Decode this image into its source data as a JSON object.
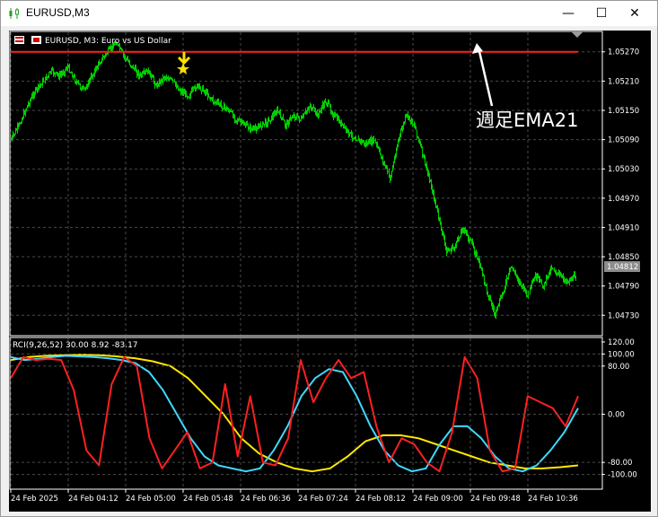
{
  "window": {
    "title": "EURUSD,M3",
    "controls": {
      "minimize": "—",
      "maximize": "☐",
      "close": "✕"
    }
  },
  "chart": {
    "header_label": "EURUSD, M3:  Euro vs US Dollar",
    "annotation": "週足EMA21",
    "current_price": "1.04812",
    "price_axis": [
      "1.05270",
      "1.05210",
      "1.05150",
      "1.05090",
      "1.05030",
      "1.04970",
      "1.04910",
      "1.04850",
      "1.04790",
      "1.04730"
    ],
    "time_axis": [
      "24 Feb 2025",
      "24 Feb 04:12",
      "24 Feb 05:00",
      "24 Feb 05:48",
      "24 Feb 06:36",
      "24 Feb 07:24",
      "24 Feb 08:12",
      "24 Feb 09:00",
      "24 Feb 09:48",
      "24 Feb 10:36"
    ],
    "ema_level": 1.0527,
    "colors": {
      "background": "#000000",
      "candles": "#00d000",
      "ema": "#ff2020",
      "grid": "#4a4a4a",
      "axis": "#ffffff",
      "marker": "#ffe000"
    }
  },
  "indicator": {
    "label": "RCI(9,26,52) 30.00 8.92 -83.17",
    "axis": [
      "120.00",
      "100.00",
      "80.00",
      "0.00",
      "-80.00",
      "-100.00"
    ],
    "colors": {
      "short": "#ff2020",
      "mid": "#40d8ff",
      "long": "#ffe800"
    }
  },
  "chart_data": {
    "type": "line",
    "title": "EURUSD, M3:  Euro vs US Dollar",
    "ylim": [
      1.0469,
      1.0531
    ],
    "series": [
      {
        "name": "EURUSD",
        "values": [
          1.0509,
          1.0512,
          1.0516,
          1.0519,
          1.0521,
          1.0523,
          1.0522,
          1.0524,
          1.0521,
          1.0519,
          1.0522,
          1.0525,
          1.0527,
          1.0529,
          1.0526,
          1.0524,
          1.0522,
          1.0523,
          1.052,
          1.0522,
          1.0521,
          1.0519,
          1.0518,
          1.052,
          1.0519,
          1.0517,
          1.0516,
          1.0515,
          1.0513,
          1.0512,
          1.0511,
          1.0512,
          1.0513,
          1.0515,
          1.0512,
          1.0514,
          1.0513,
          1.0516,
          1.0514,
          1.0517,
          1.0514,
          1.0512,
          1.051,
          1.0509,
          1.0508,
          1.0509,
          1.0505,
          1.0501,
          1.0509,
          1.0514,
          1.0512,
          1.0506,
          1.05,
          1.0493,
          1.0486,
          1.0487,
          1.0491,
          1.0488,
          1.0484,
          1.0478,
          1.0473,
          1.0478,
          1.0483,
          1.048,
          1.0477,
          1.0481,
          1.0479,
          1.0483,
          1.0481,
          1.048,
          1.0481
        ]
      },
      {
        "name": "EMA21",
        "values": [
          1.0527
        ]
      }
    ]
  },
  "rci_data": {
    "short": [
      60,
      95,
      90,
      92,
      90,
      40,
      -60,
      -85,
      50,
      95,
      80,
      -40,
      -90,
      -60,
      -30,
      -90,
      -80,
      50,
      -70,
      30,
      -80,
      -85,
      -40,
      90,
      20,
      60,
      90,
      60,
      70,
      -20,
      -80,
      -40,
      -50,
      -80,
      -95,
      -30,
      95,
      60,
      -60,
      -95,
      -90,
      30,
      20,
      10,
      -20,
      30
    ],
    "mid": [
      95,
      90,
      92,
      95,
      97,
      96,
      95,
      93,
      90,
      85,
      70,
      40,
      0,
      -40,
      -70,
      -85,
      -90,
      -95,
      -90,
      -60,
      -20,
      30,
      60,
      75,
      70,
      30,
      -20,
      -60,
      -85,
      -95,
      -90,
      -50,
      -20,
      -20,
      -40,
      -70,
      -90,
      -95,
      -85,
      -60,
      -30,
      10
    ],
    "long": [
      90,
      95,
      97,
      98,
      99,
      98,
      96,
      93,
      88,
      80,
      60,
      30,
      0,
      -40,
      -65,
      -80,
      -90,
      -95,
      -90,
      -70,
      -45,
      -35,
      -35,
      -40,
      -50,
      -60,
      -70,
      -80,
      -85,
      -90,
      -90,
      -88,
      -85
    ]
  }
}
